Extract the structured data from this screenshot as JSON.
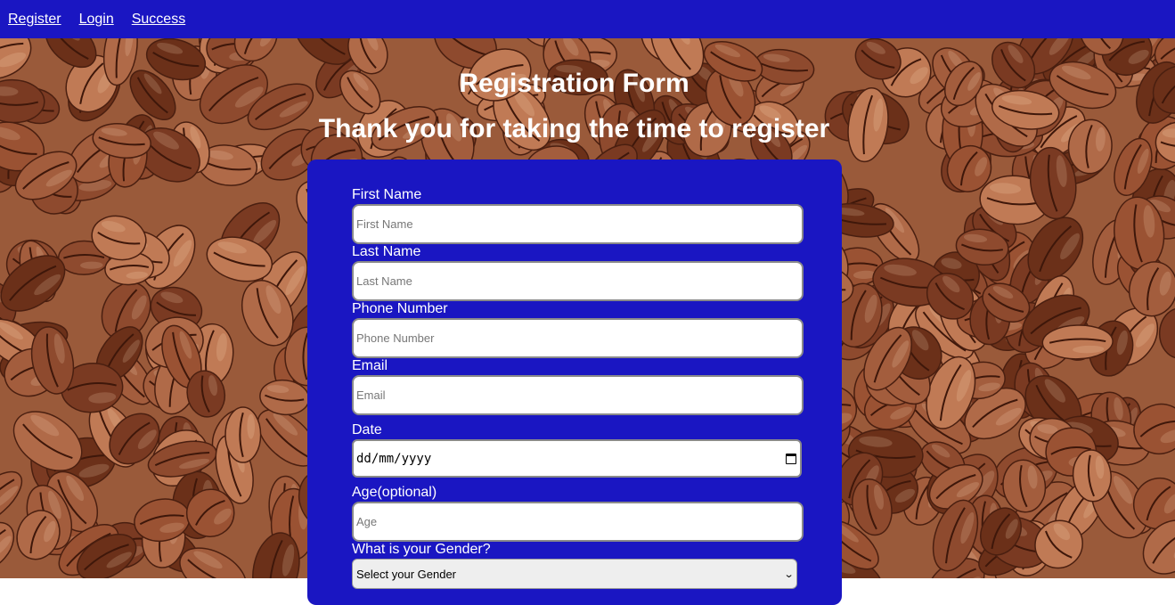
{
  "nav": {
    "items": [
      {
        "label": "Register"
      },
      {
        "label": "Login"
      },
      {
        "label": "Success"
      }
    ]
  },
  "header": {
    "title": "Registration Form",
    "subtitle": "Thank you for taking the time to register"
  },
  "form": {
    "first_name": {
      "label": "First Name",
      "placeholder": "First Name",
      "value": ""
    },
    "last_name": {
      "label": "Last Name",
      "placeholder": "Last Name",
      "value": ""
    },
    "phone": {
      "label": "Phone Number",
      "placeholder": "Phone Number",
      "value": ""
    },
    "email": {
      "label": "Email",
      "placeholder": "Email",
      "value": ""
    },
    "date": {
      "label": "Date",
      "value": "dd/mm/yyyy",
      "icon": "calendar-icon"
    },
    "age": {
      "label": "Age(optional)",
      "placeholder": "Age",
      "value": ""
    },
    "gender": {
      "label": "What is your Gender?",
      "selected": "Select your Gender",
      "icon": "chevron-down-icon"
    }
  },
  "colors": {
    "primary": "#1a16c2",
    "background_image": "coffee beans",
    "text": "#ffffff"
  }
}
